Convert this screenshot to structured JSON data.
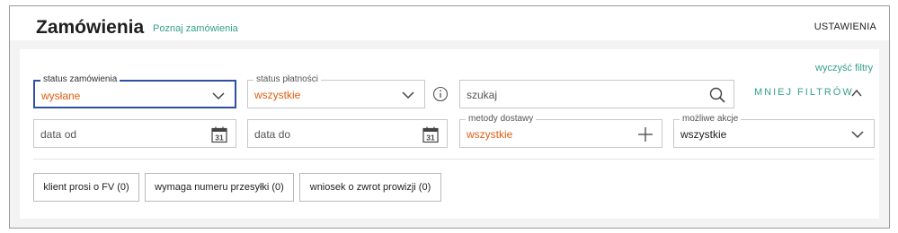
{
  "header": {
    "title": "Zamówienia",
    "subtitle_link": "Poznaj zamówienia",
    "settings_link": "USTAWIENIA"
  },
  "filters": {
    "clear_link": "wyczyść filtry",
    "less_filters": "MNIEJ FILTRÓW",
    "order_status": {
      "label": "status zamówienia",
      "value": "wysłane"
    },
    "payment_status": {
      "label": "status płatności",
      "value": "wszystkie"
    },
    "search": {
      "placeholder": "szukaj"
    },
    "date_from": {
      "placeholder": "data od",
      "calendar_day": "31"
    },
    "date_to": {
      "placeholder": "data do",
      "calendar_day": "31"
    },
    "delivery_methods": {
      "label": "metody dostawy",
      "value": "wszystkie"
    },
    "possible_actions": {
      "label": "możliwe akcje",
      "value": "wszystkie"
    }
  },
  "chips": [
    {
      "label": "klient prosi o FV (0)"
    },
    {
      "label": "wymaga numeru przesyłki (0)"
    },
    {
      "label": "wniosek o zwrot prowizji (0)"
    }
  ],
  "colors": {
    "accent_green": "#35a089",
    "value_orange": "#e05e10",
    "active_border": "#2d4fa6"
  },
  "icons": [
    "chevron-down-icon",
    "info-icon",
    "search-icon",
    "calendar-icon",
    "plus-icon",
    "chevron-up-icon"
  ]
}
